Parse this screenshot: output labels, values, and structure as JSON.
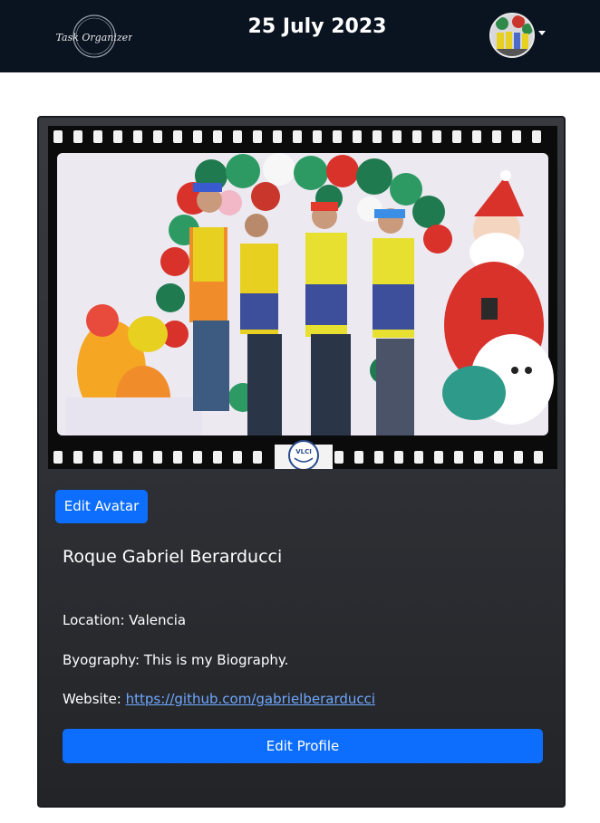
{
  "navbar": {
    "logo_text": "Task Organizer",
    "date": "25 July 2023"
  },
  "profile": {
    "edit_avatar_label": "Edit Avatar",
    "name": "Roque Gabriel Berarducci",
    "location_label": "Location:",
    "location_value": "Valencia",
    "biography_label": "Byography:",
    "biography_value": "This is my Biography.",
    "website_label": "Website:",
    "website_value": "https://github.com/gabrielberarducci",
    "edit_profile_label": "Edit Profile",
    "photo_badge_text": "VLCI"
  },
  "colors": {
    "navbar_bg": "#0a1421",
    "accent": "#0d6efd",
    "card_bg": "#2f3136",
    "link": "#6ea8fe"
  }
}
